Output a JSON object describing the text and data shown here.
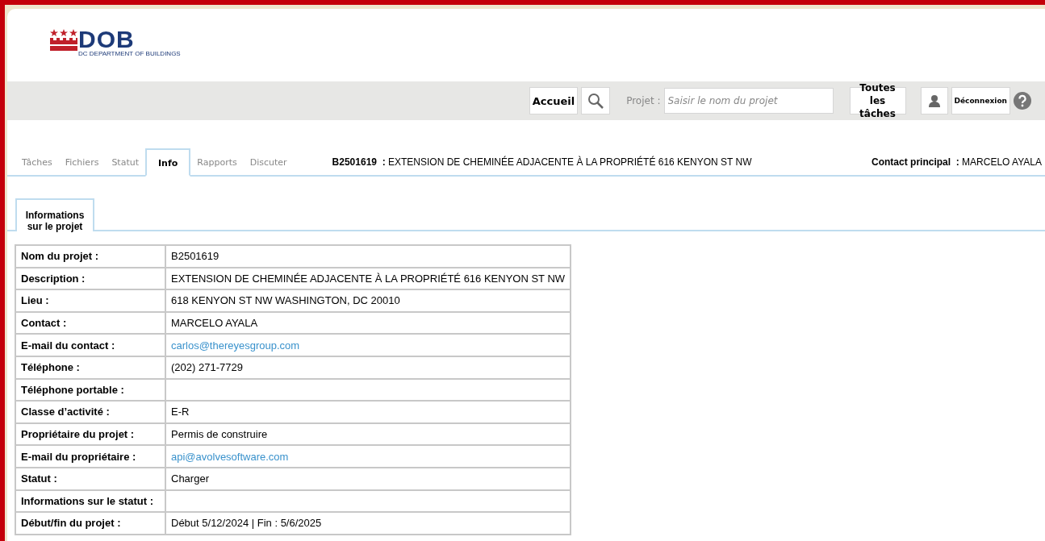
{
  "logo": {
    "text": "DOB",
    "subtitle": "DC DEPARTMENT OF BUILDINGS"
  },
  "toolbar": {
    "home_button": "Accueil",
    "project_label": "Projet :",
    "project_search": {
      "placeholder": "Saisir le nom du projet"
    },
    "all_tasks_button": "Toutes les tâches",
    "logout_button": "Déconnexion"
  },
  "tabs": [
    {
      "label": "Tâches",
      "selected": false
    },
    {
      "label": "Fichiers",
      "selected": false
    },
    {
      "label": "Statut",
      "selected": false
    },
    {
      "label": "Info",
      "selected": true
    },
    {
      "label": "Rapports",
      "selected": false
    },
    {
      "label": "Discuter",
      "selected": false
    }
  ],
  "project_header": {
    "id": "B2501619",
    "separator": ":",
    "description": "EXTENSION DE CHEMINÉE ADJACENTE À LA PROPRIÉTÉ 616 KENYON ST NW",
    "contact_label": "Contact principal",
    "contact_separator": ":",
    "contact": "MARCELO AYALA"
  },
  "subtabs": [
    {
      "label": "Informations sur le projet"
    }
  ],
  "table": {
    "rows": [
      {
        "label": "Nom du projet  :",
        "value": "B2501619",
        "kind": "text"
      },
      {
        "label": "Description  :",
        "value": "EXTENSION DE CHEMINÉE ADJACENTE À LA PROPRIÉTÉ 616 KENYON ST NW",
        "kind": "text"
      },
      {
        "label": "Lieu  :",
        "value": "618 KENYON ST NW WASHINGTON, DC 20010",
        "kind": "text"
      },
      {
        "label": "Contact  :",
        "value": "MARCELO AYALA",
        "kind": "text"
      },
      {
        "label": "E-mail du contact  :",
        "value": "carlos@thereyesgroup.com",
        "kind": "link"
      },
      {
        "label": "Téléphone  :",
        "value": "(202) 271-7729",
        "kind": "text"
      },
      {
        "label": "Téléphone portable  :",
        "kind": "text"
      },
      {
        "label": "Classe d’activité  :",
        "value": "E-R",
        "kind": "text"
      },
      {
        "label": "Propriétaire du projet  :",
        "value": "Permis de construire",
        "kind": "text"
      },
      {
        "label": "E-mail du propriétaire  :",
        "value": "api@avolvesoftware.com",
        "kind": "link"
      },
      {
        "label": "Statut  :",
        "value": "Charger",
        "kind": "text"
      },
      {
        "label": "Informations sur le statut  :",
        "kind": "text"
      },
      {
        "label": "Début/fin du projet  :",
        "value": "Début 5/12/2024 | Fin : 5/6/2025",
        "kind": "text"
      }
    ]
  }
}
